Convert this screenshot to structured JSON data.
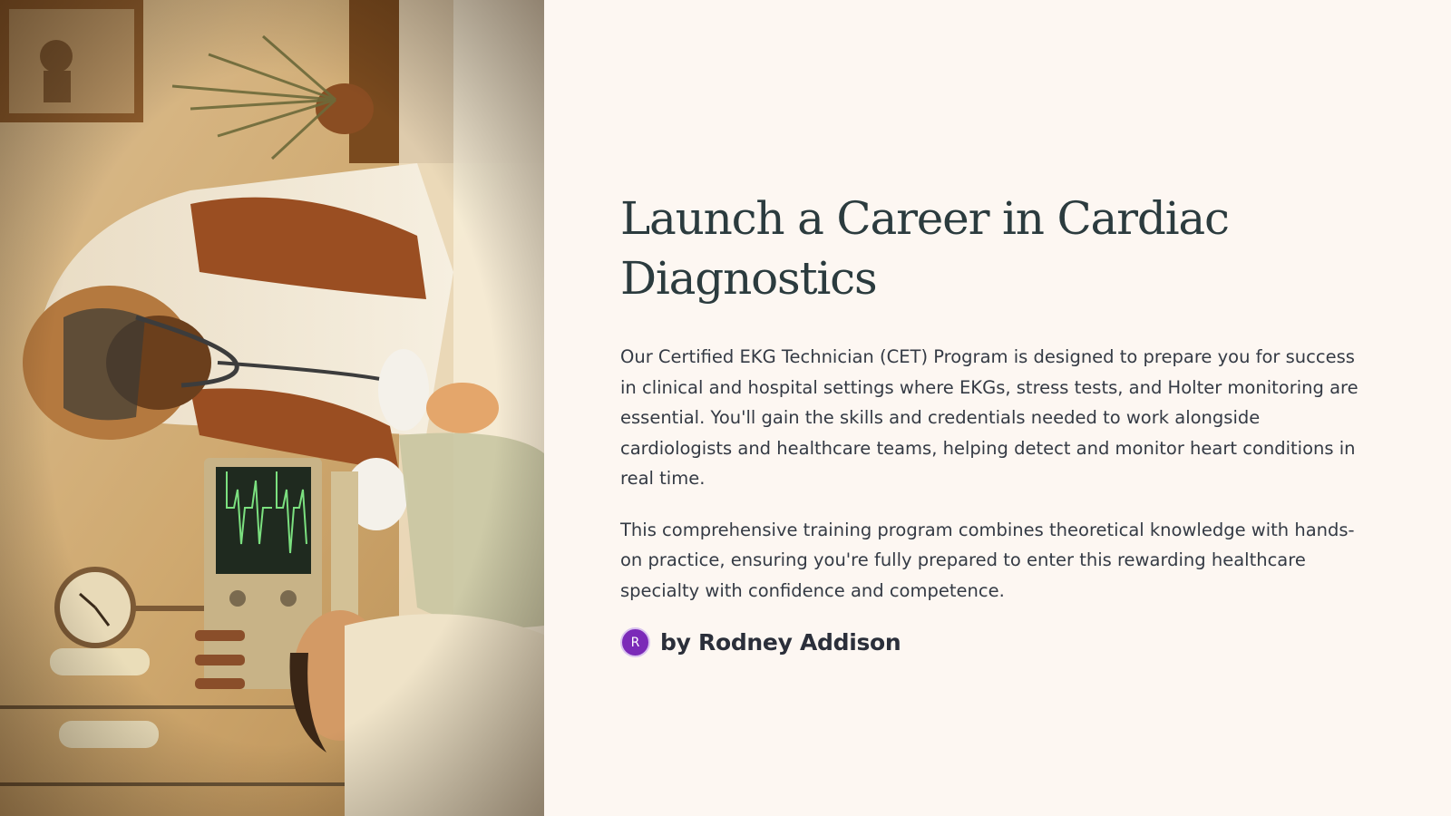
{
  "hero_image": {
    "description_icon": "ekg-technician-illustration"
  },
  "slide": {
    "title": "Launch a Career in Cardiac Diagnostics",
    "paragraphs": [
      "Our Certified EKG Technician (CET) Program is designed to prepare you for success in clinical and hospital settings where EKGs, stress tests, and Holter monitoring are essential. You'll gain the skills and credentials needed to work alongside cardiologists and healthcare teams, helping detect and monitor heart conditions in real time.",
      "This comprehensive training program combines theoretical knowledge with hands-on practice, ensuring you're fully prepared to enter this rewarding healthcare specialty with confidence and competence."
    ],
    "author": {
      "initial": "R",
      "name": "by Rodney Addison",
      "avatar_color": "#7b2ab8"
    }
  },
  "colors": {
    "background": "#fdf7f2",
    "title": "#2b3b3e",
    "body_text": "#343a44"
  }
}
